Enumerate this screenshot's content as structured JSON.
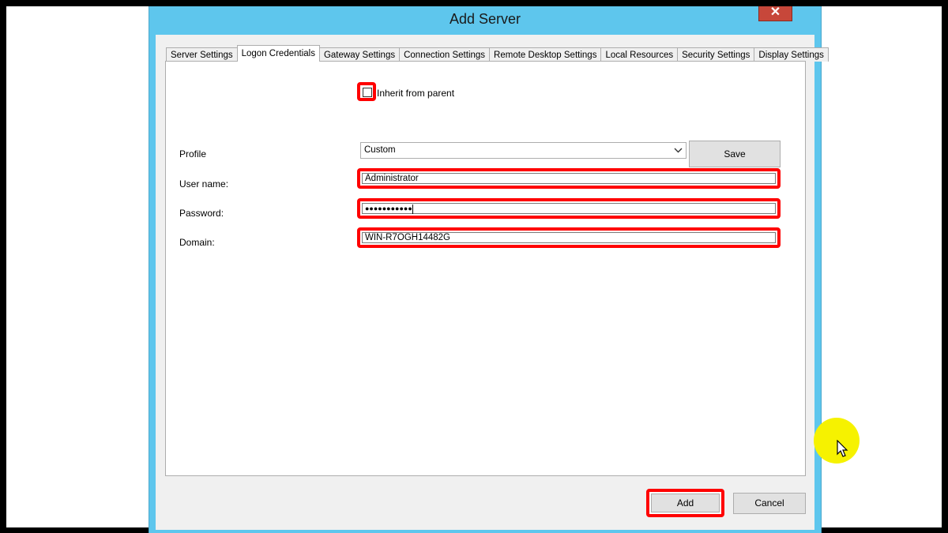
{
  "window": {
    "title": "Add Server",
    "close_glyph": "✕"
  },
  "tabs": [
    {
      "label": "Server Settings",
      "active": false
    },
    {
      "label": "Logon Credentials",
      "active": true
    },
    {
      "label": "Gateway Settings",
      "active": false
    },
    {
      "label": "Connection Settings",
      "active": false
    },
    {
      "label": "Remote Desktop Settings",
      "active": false
    },
    {
      "label": "Local Resources",
      "active": false
    },
    {
      "label": "Security Settings",
      "active": false
    },
    {
      "label": "Display Settings",
      "active": false
    }
  ],
  "inherit": {
    "label": "Inherit from parent",
    "checked": false
  },
  "form": {
    "profile_label": "Profile",
    "profile_value": "Custom",
    "save_label": "Save",
    "username_label": "User name:",
    "username_value": "Administrator",
    "password_label": "Password:",
    "password_value": "●●●●●●●●●●●",
    "domain_label": "Domain:",
    "domain_value": "WIN-R7OGH14482G"
  },
  "footer": {
    "add_label": "Add",
    "cancel_label": "Cancel"
  },
  "colors": {
    "highlight": "#ff0000",
    "window_frame": "#5ec6ed",
    "cursor_halo": "#f6f200"
  }
}
